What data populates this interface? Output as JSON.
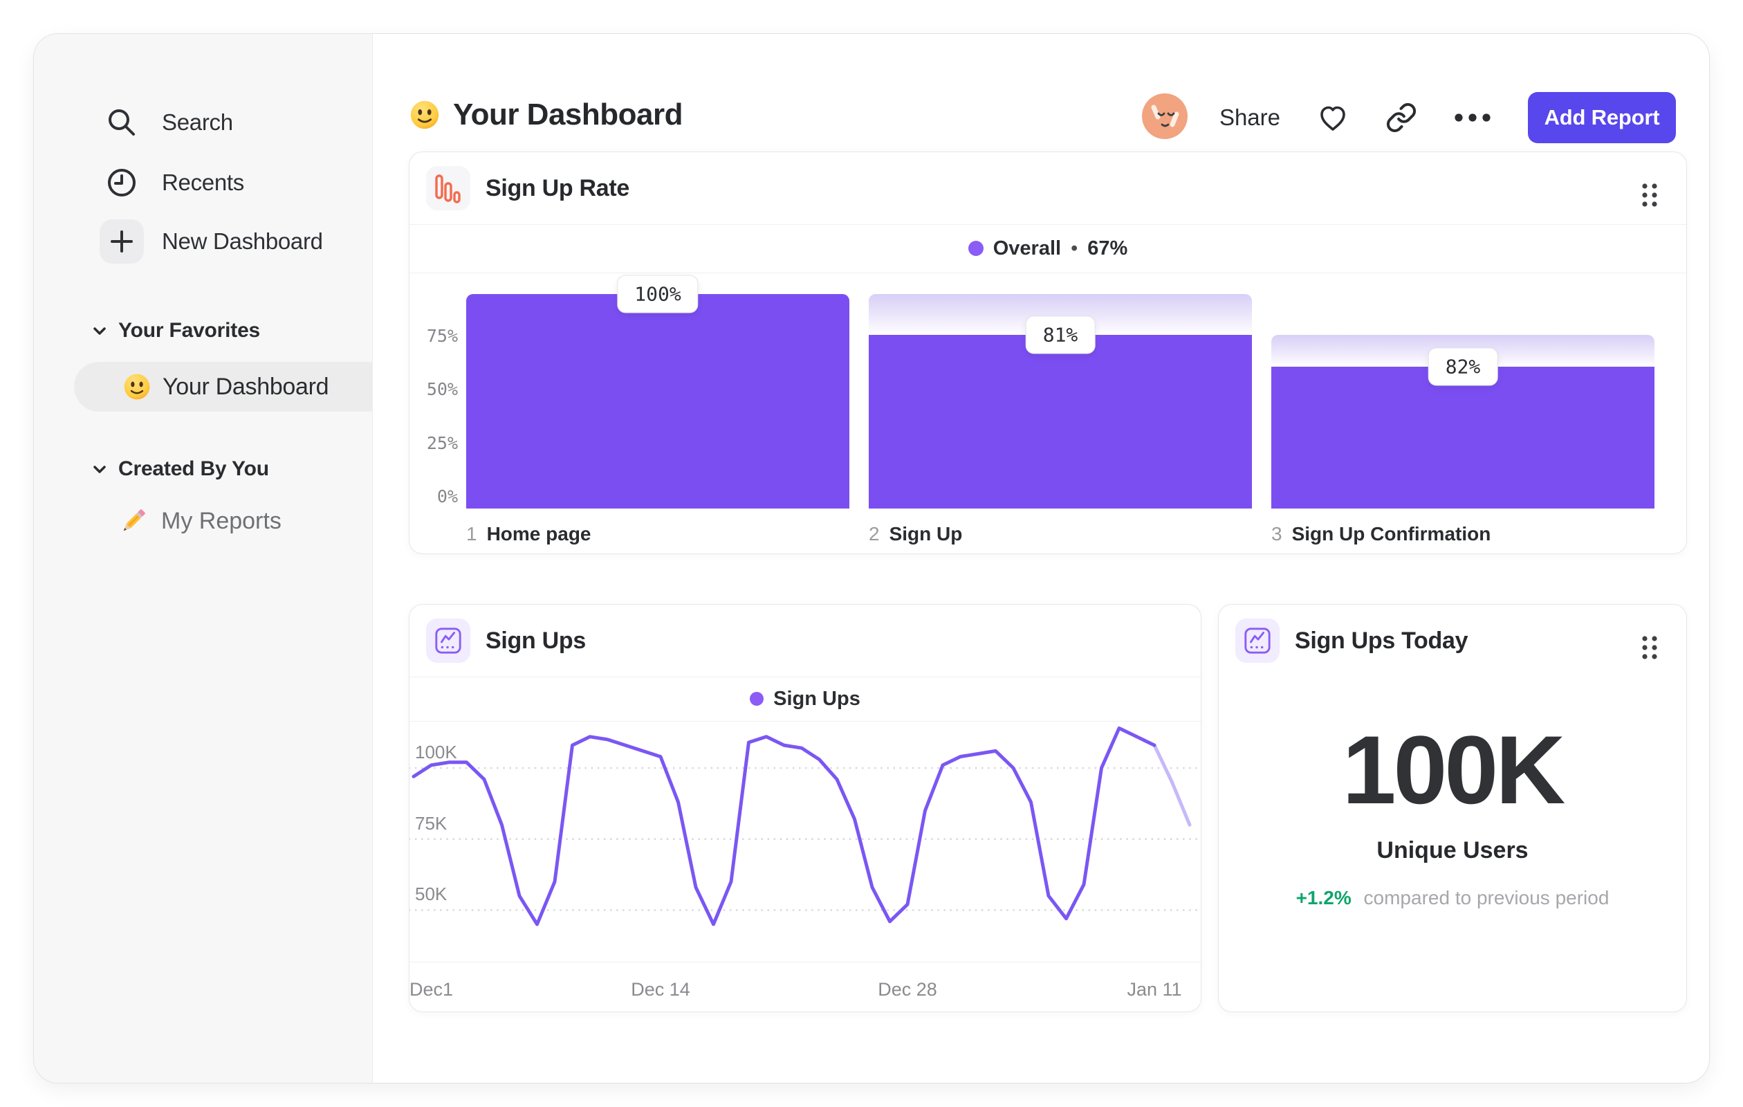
{
  "colors": {
    "accent_purple": "#7B4EF2",
    "line_purple": "#7A57F3",
    "line_faded": "#C7B9F9",
    "legend_dot": "#8B5CF6",
    "button_purple": "#5847EC",
    "coral_icon": "#F26B4E",
    "lavender_tile": "#F1ECFE",
    "gray_tile": "#F6F5F7",
    "green_positive": "#0FA56C",
    "avatar_peach": "#F2A380"
  },
  "sidebar": {
    "search": "Search",
    "recents": "Recents",
    "new_dashboard": "New Dashboard",
    "favorites_header": "Your Favorites",
    "your_dashboard": "Your Dashboard",
    "created_header": "Created By You",
    "my_reports": "My Reports"
  },
  "header": {
    "title": "Your Dashboard",
    "share": "Share",
    "add_report": "Add Report"
  },
  "cards": {
    "funnel": {
      "title": "Sign Up Rate",
      "legend_name": "Overall",
      "legend_sep": "•",
      "legend_value": "67%"
    },
    "line": {
      "title": "Sign Ups",
      "legend_name": "Sign Ups"
    },
    "stat": {
      "title": "Sign Ups Today",
      "value": "100K",
      "label": "Unique Users",
      "delta": "+1.2%",
      "delta_desc": "compared to previous period"
    }
  },
  "chart_data": [
    {
      "type": "bar",
      "subtype": "funnel",
      "title": "Sign Up Rate",
      "legend": "Overall",
      "overall_conversion_pct": 67,
      "ylim": [
        0,
        100
      ],
      "y_ticks": [
        "75%",
        "50%",
        "25%",
        "0%"
      ],
      "y_tick_values": [
        75,
        50,
        25,
        0
      ],
      "steps": [
        {
          "index": "1",
          "label": "Home page",
          "step_conversion": "100%",
          "conversion_from_previous_pct": 100,
          "absolute_pct": 100,
          "prior_absolute_pct": 100
        },
        {
          "index": "2",
          "label": "Sign Up",
          "step_conversion": "81%",
          "conversion_from_previous_pct": 81,
          "absolute_pct": 81,
          "prior_absolute_pct": 100
        },
        {
          "index": "3",
          "label": "Sign Up Confirmation",
          "step_conversion": "82%",
          "conversion_from_previous_pct": 82,
          "absolute_pct": 66,
          "prior_absolute_pct": 81
        }
      ]
    },
    {
      "type": "line",
      "title": "Sign Ups",
      "series_name": "Sign Ups",
      "unit": "K",
      "grid": "dashed-horizontal",
      "legend_position": "top-center",
      "ylim": [
        40,
        118
      ],
      "y_ticks": [
        {
          "label": "100K",
          "value": 100
        },
        {
          "label": "75K",
          "value": 75
        },
        {
          "label": "50K",
          "value": 50
        }
      ],
      "x_ticks": [
        {
          "label": "Dec1",
          "day": 1
        },
        {
          "label": "Dec 14",
          "day": 14
        },
        {
          "label": "Dec 28",
          "day": 28
        },
        {
          "label": "Jan 11",
          "day": 42
        }
      ],
      "x_is_day_index": true,
      "values_k": [
        97,
        101,
        102,
        102,
        96,
        80,
        55,
        45,
        60,
        108,
        111,
        110,
        108,
        106,
        104,
        88,
        58,
        45,
        60,
        109,
        111,
        108,
        107,
        103,
        96,
        82,
        58,
        46,
        52,
        85,
        101,
        104,
        105,
        106,
        100,
        88,
        55,
        47,
        59,
        100,
        114,
        111,
        108,
        95,
        80
      ],
      "faded_from_day": 42
    }
  ]
}
